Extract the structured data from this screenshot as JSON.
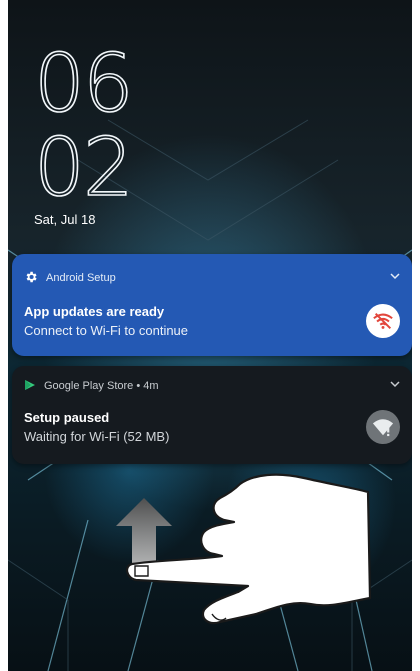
{
  "lockscreen": {
    "clock_hours": "06",
    "clock_minutes": "02",
    "date": "Sat, Jul 18"
  },
  "notifications": [
    {
      "app_name": "Android Setup",
      "app_icon": "gear-icon",
      "title": "App updates are ready",
      "text": "Connect to Wi-Fi to continue",
      "action_icon": "wifi-off-icon",
      "background_color": "#2459b4"
    },
    {
      "app_name": "Google Play Store • 4m",
      "app_icon": "play-store-icon",
      "title": "Setup paused",
      "text": "Waiting for Wi-Fi (52 MB)",
      "action_icon": "wifi-alert-icon",
      "background_color": "#151a1f"
    }
  ],
  "gesture_overlay": {
    "icon": "hand-swipe-up-icon",
    "direction": "up"
  }
}
